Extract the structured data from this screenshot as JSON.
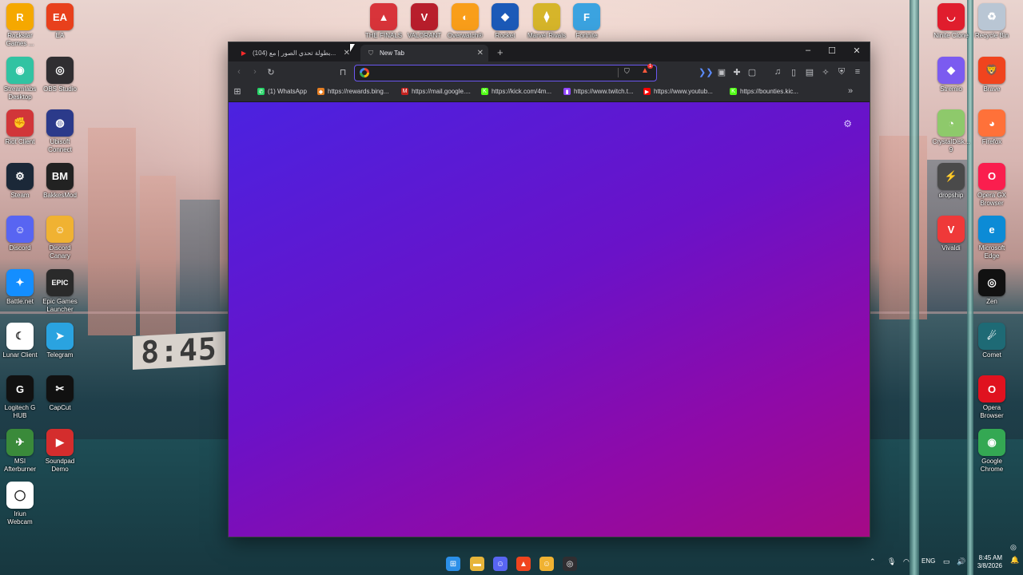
{
  "wallpaper": {
    "clock_sign": "8:45"
  },
  "desktop_icons_left": [
    {
      "label": "Rockstar\nGames ...",
      "icon": "rockstar-icon",
      "glyph": "R",
      "color": "#f5a800"
    },
    {
      "label": "EA",
      "icon": "ea-icon",
      "glyph": "EA",
      "color": "#e8401c"
    },
    {
      "label": "Streamlabs\nDesktop",
      "icon": "streamlabs-icon",
      "glyph": "◉",
      "color": "#31c3a2"
    },
    {
      "label": "OBS Studio",
      "icon": "obs-icon",
      "glyph": "◎",
      "color": "#302e31"
    },
    {
      "label": "Riot Client",
      "icon": "riot-icon",
      "glyph": "✊",
      "color": "#d13639"
    },
    {
      "label": "Ubisoft\nConnect",
      "icon": "ubisoft-icon",
      "glyph": "◍",
      "color": "#2b3a8a"
    },
    {
      "label": "Steam",
      "icon": "steam-icon",
      "glyph": "⚙",
      "color": "#1b2838"
    },
    {
      "label": "BakkesMod",
      "icon": "bakkesmod-icon",
      "glyph": "BM",
      "color": "#222"
    },
    {
      "label": "Discord",
      "icon": "discord-icon",
      "glyph": "☺",
      "color": "#5865f2"
    },
    {
      "label": "Discord\nCanary",
      "icon": "discord-canary-icon",
      "glyph": "☺",
      "color": "#f0b232"
    },
    {
      "label": "Battle.net",
      "icon": "battlenet-icon",
      "glyph": "✦",
      "color": "#148eff"
    },
    {
      "label": "Epic Games\nLauncher",
      "icon": "epic-games-icon",
      "glyph": "EPIC",
      "color": "#2a2a2a"
    },
    {
      "label": "Lunar Client",
      "icon": "lunar-client-icon",
      "glyph": "☾",
      "color": "#ffffff"
    },
    {
      "label": "Telegram",
      "icon": "telegram-icon",
      "glyph": "➤",
      "color": "#2aa3e0"
    },
    {
      "label": "Logitech G\nHUB",
      "icon": "logitech-icon",
      "glyph": "G",
      "color": "#111"
    },
    {
      "label": "CapCut",
      "icon": "capcut-icon",
      "glyph": "✂",
      "color": "#111"
    },
    {
      "label": "MSI\nAfterburner",
      "icon": "msi-afterburner-icon",
      "glyph": "✈",
      "color": "#3a8a3a"
    },
    {
      "label": "Soundpad\nDemo",
      "icon": "soundpad-icon",
      "glyph": "▶",
      "color": "#d42d2d"
    },
    {
      "label": "Iriun\nWebcam",
      "icon": "iriun-icon",
      "glyph": "◯",
      "color": "#ffffff"
    }
  ],
  "desktop_icons_top": [
    {
      "label": "THE FINALS",
      "icon": "the-finals-icon",
      "glyph": "▲",
      "color": "#d8343a"
    },
    {
      "label": "VALORANT",
      "icon": "valorant-icon",
      "glyph": "V",
      "color": "#b81e2c"
    },
    {
      "label": "Overwatch®",
      "icon": "overwatch-icon",
      "glyph": "◐",
      "color": "#f99e1a"
    },
    {
      "label": "Rocket",
      "icon": "rocket-league-icon",
      "glyph": "◆",
      "color": "#1c5ab8"
    },
    {
      "label": "Marvel Rivals",
      "icon": "marvel-rivals-icon",
      "glyph": "⧫",
      "color": "#d6b52a"
    },
    {
      "label": "Fortnite",
      "icon": "fortnite-icon",
      "glyph": "F",
      "color": "#3ba3e0"
    }
  ],
  "desktop_icons_right": [
    {
      "label": "Ninite Clone",
      "icon": "ninite-icon",
      "glyph": "◡",
      "color": "#e01d2d"
    },
    {
      "label": "Recycle Bin",
      "icon": "recycle-bin-icon",
      "glyph": "♻",
      "color": "#b9c6d4"
    },
    {
      "label": "Stremio",
      "icon": "stremio-icon",
      "glyph": "◆",
      "color": "#7b5bf0"
    },
    {
      "label": "Brave",
      "icon": "brave-icon",
      "glyph": "🦁",
      "color": "#f0441e"
    },
    {
      "label": "CrystalDisk...\n9",
      "icon": "crystaldisk-icon",
      "glyph": "◔",
      "color": "#8ec96b"
    },
    {
      "label": "Firefox",
      "icon": "firefox-icon",
      "glyph": "◕",
      "color": "#ff7139"
    },
    {
      "label": "dropship",
      "icon": "dropship-icon",
      "glyph": "⚡",
      "color": "#4a4a4a"
    },
    {
      "label": "Opera GX\nBrowser",
      "icon": "opera-gx-icon",
      "glyph": "O",
      "color": "#fa1e4e"
    },
    {
      "label": "Vivaldi",
      "icon": "vivaldi-icon",
      "glyph": "V",
      "color": "#ef3939"
    },
    {
      "label": "Microsoft\nEdge",
      "icon": "edge-icon",
      "glyph": "e",
      "color": "#0c8bd6"
    },
    {
      "label": "Zen",
      "icon": "zen-icon",
      "glyph": "◎",
      "color": "#111"
    },
    {
      "label": "Comet",
      "icon": "comet-icon",
      "glyph": "☄",
      "color": "#1e6a75"
    },
    {
      "label": "Opera\nBrowser",
      "icon": "opera-icon",
      "glyph": "O",
      "color": "#e0121f"
    },
    {
      "label": "Google\nChrome",
      "icon": "chrome-icon",
      "glyph": "◉",
      "color": "#34a853"
    }
  ],
  "browser": {
    "tabs": [
      {
        "label": "(104) بطولة تحدي الصور | مع...",
        "icon": "youtube-icon",
        "active": false
      },
      {
        "label": "New Tab",
        "icon": "shield-icon",
        "active": true
      }
    ],
    "new_tab_label": "+",
    "window_controls": {
      "minimize": "–",
      "maximize": "☐",
      "close": "✕"
    },
    "address": {
      "value": "",
      "placeholder": ""
    },
    "brave_rewards_count": "1",
    "bookmarks": [
      {
        "label": "(1) WhatsApp",
        "icon": "whatsapp-icon",
        "color": "#25d366",
        "glyph": "✆"
      },
      {
        "label": "https://rewards.bing...",
        "icon": "rewards-icon",
        "color": "#e67e22",
        "glyph": "◆"
      },
      {
        "label": "https://mail.google....",
        "icon": "gmail-icon",
        "color": "#c5221f",
        "glyph": "M"
      },
      {
        "label": "https://kick.com/4m...",
        "icon": "kick-icon",
        "color": "#53fc18",
        "glyph": "K"
      },
      {
        "label": "https://www.twitch.t...",
        "icon": "twitch-icon",
        "color": "#9146ff",
        "glyph": "▮"
      },
      {
        "label": "https://www.youtub...",
        "icon": "youtube-icon",
        "color": "#ff0000",
        "glyph": "▶"
      },
      {
        "label": "https://bounties.kic...",
        "icon": "kick-icon",
        "color": "#53fc18",
        "glyph": "K"
      }
    ],
    "bookmarks_overflow": "»"
  },
  "taskbar": {
    "apps": [
      {
        "icon": "windows-start-icon",
        "glyph": "⊞",
        "color": "#2b8fe8"
      },
      {
        "icon": "file-explorer-icon",
        "glyph": "▬",
        "color": "#e7b53a"
      },
      {
        "icon": "discord-icon",
        "glyph": "☺",
        "color": "#5865f2"
      },
      {
        "icon": "brave-icon",
        "glyph": "▲",
        "color": "#f0441e"
      },
      {
        "icon": "discord-canary-icon",
        "glyph": "☺",
        "color": "#f0b232"
      },
      {
        "icon": "obs-icon",
        "glyph": "◎",
        "color": "#302e31"
      }
    ],
    "language": "ENG",
    "time": "8:45 AM",
    "date": "3/8/2026"
  }
}
